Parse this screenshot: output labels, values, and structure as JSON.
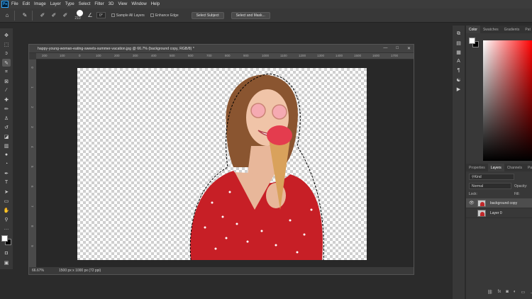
{
  "app": {
    "logo": "Ps"
  },
  "menu": [
    "File",
    "Edit",
    "Image",
    "Layer",
    "Type",
    "Select",
    "Filter",
    "3D",
    "View",
    "Window",
    "Help"
  ],
  "options": {
    "brush_size": "210",
    "angle": "0°",
    "sample_all_layers": "Sample All Layers",
    "enhance_edge": "Enhance Edge",
    "select_subject": "Select Subject",
    "select_and_mask": "Select and Mask..."
  },
  "document": {
    "title": "happy-young-woman-eating-sweets-summer-vacation.jpg @ 66.7% (background copy, RGB/8) *",
    "ruler_h": [
      "200",
      "100",
      "0",
      "100",
      "200",
      "300",
      "400",
      "500",
      "600",
      "700",
      "800",
      "900",
      "1000",
      "1100",
      "1200",
      "1300",
      "1400",
      "1500",
      "1600",
      "1700"
    ],
    "ruler_v": [
      "0",
      "1",
      "2",
      "3",
      "4",
      "5",
      "6",
      "7",
      "8",
      "9"
    ],
    "zoom": "66.67%",
    "dimensions": "1500 px x 1000 px (72 ppi)"
  },
  "color_panel": {
    "tabs": [
      "Color",
      "Swatches",
      "Gradients",
      "Pat"
    ]
  },
  "layers_panel": {
    "tabs": [
      "Properties",
      "Layers",
      "Channels",
      "Pa"
    ],
    "kind": "Kind",
    "blend_mode": "Normal",
    "opacity_label": "Opacity:",
    "lock_label": "Lock:",
    "fill_label": "Fill:",
    "layers": [
      {
        "name": "background copy",
        "visible": true,
        "selected": true
      },
      {
        "name": "Layer 0",
        "visible": false,
        "selected": false
      }
    ]
  },
  "colors": {
    "accent": "#31a8ff",
    "dress_red": "#c0282a"
  }
}
